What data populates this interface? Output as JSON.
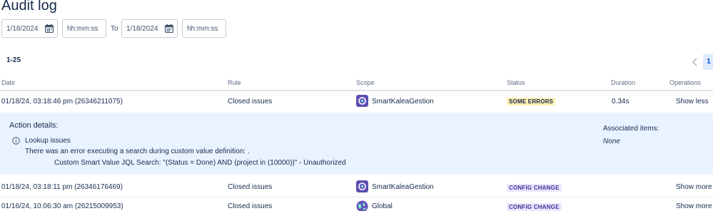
{
  "page": {
    "title": "Audit log"
  },
  "filters": {
    "from_date": "1/18/2024",
    "from_time_placeholder": "hh:mm:ss",
    "to_label": "To",
    "to_date": "1/18/2024",
    "to_time_placeholder": "hh:mm:ss"
  },
  "pagination": {
    "range": "1-25",
    "current_page": "1"
  },
  "table": {
    "headers": {
      "date": "Date",
      "rule": "Rule",
      "scope": "Scope",
      "status": "Status",
      "duration": "Duration",
      "operations": "Operations"
    },
    "rows": [
      {
        "date": "01/18/24, 03:18:46 pm (26346211075)",
        "rule": "Closed issues",
        "scope": "SmartKaleaGestion",
        "scope_icon": "project-icon",
        "status": "SOME ERRORS",
        "duration": "0.34s",
        "operation": "Show less"
      },
      {
        "date": "01/18/24, 03:18:11 pm (26346176469)",
        "rule": "Closed issues",
        "scope": "SmartKaleaGestion",
        "scope_icon": "project-icon",
        "status": "CONFIG CHANGE",
        "duration": "",
        "operation": "Show more"
      },
      {
        "date": "01/16/24, 10:06:30 am (26215009953)",
        "rule": "Closed issues",
        "scope": "Global",
        "scope_icon": "globe-icon",
        "status": "CONFIG CHANGE",
        "duration": "",
        "operation": "Show more"
      }
    ]
  },
  "details": {
    "heading": "Action details:",
    "action": "Lookup issues",
    "message": "There was an error executing a search during custom value definition: .",
    "sub_message": "Custom Smart Value JQL Search: \"(Status = Done) AND (project in (10000))\" - Unauthorized",
    "associated_heading": "Associated items:",
    "associated_value": "None"
  },
  "colors": {
    "accent": "#0052cc",
    "details_bg": "#e9f2ff",
    "some_errors_bg": "#fff0b3",
    "config_change_bg": "#eae6ff"
  }
}
